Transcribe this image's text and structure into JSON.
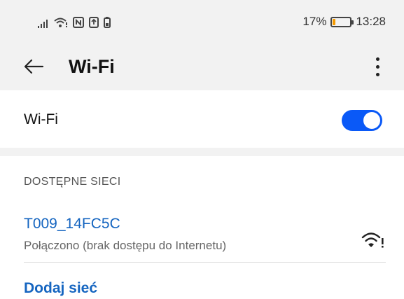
{
  "statusbar": {
    "battery_percent": "17%",
    "time": "13:28",
    "battery_level": 0.17,
    "icons": [
      "signal-icon",
      "wifi-icon",
      "nfc-icon",
      "upload-icon",
      "battery-small-icon"
    ]
  },
  "appbar": {
    "title": "Wi-Fi",
    "back_icon": "back-arrow-icon",
    "more_icon": "more-vertical-icon"
  },
  "wifi_toggle": {
    "label": "Wi-Fi",
    "enabled": true,
    "accent_color": "#0a59f7"
  },
  "available": {
    "header": "DOSTĘPNE SIECI",
    "networks": [
      {
        "name": "T009_14FC5C",
        "status": "Połączono (brak dostępu do Internetu)",
        "icon": "wifi-no-internet-icon"
      }
    ]
  },
  "add_network": {
    "label": "Dodaj sieć",
    "link_color": "#1565c0"
  }
}
